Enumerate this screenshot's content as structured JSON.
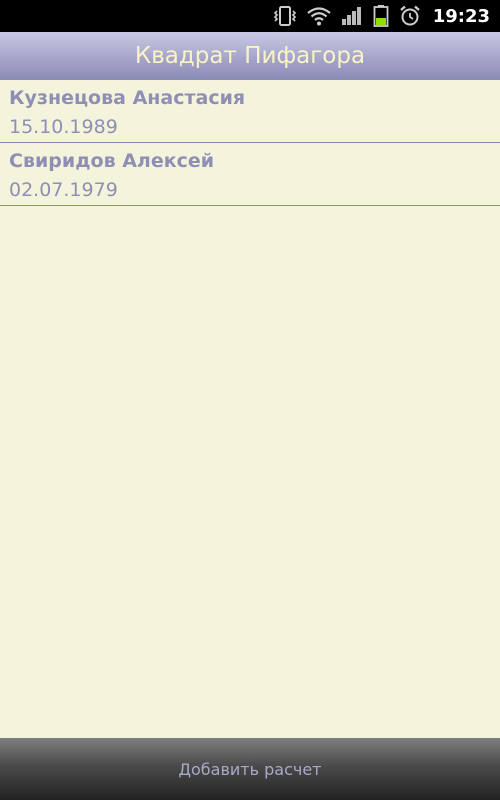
{
  "status_bar": {
    "time": "19:23",
    "icons": [
      "vibrate-icon",
      "wifi-icon",
      "signal-icon",
      "battery-icon",
      "alarm-icon"
    ],
    "battery_color": "#8ee000"
  },
  "header": {
    "title": "Квадрат Пифагора"
  },
  "list": {
    "items": [
      {
        "name": "Кузнецова Анастасия",
        "date": "15.10.1989"
      },
      {
        "name": "Свиридов Алексей",
        "date": "02.07.1979"
      }
    ]
  },
  "footer": {
    "add_label": "Добавить расчет"
  },
  "colors": {
    "background": "#f4f4dc",
    "title_text": "#fbf3c6",
    "list_text": "#8f8fb6"
  }
}
